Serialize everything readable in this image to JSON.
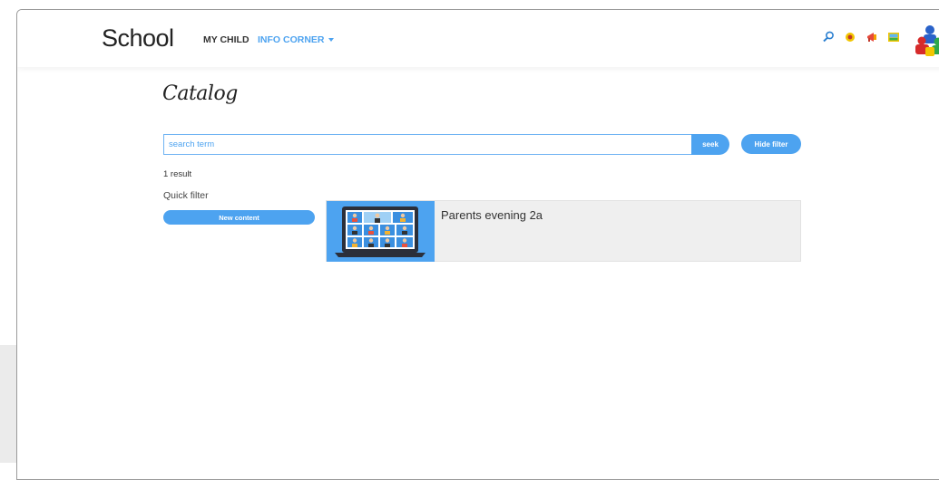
{
  "header": {
    "brand": "School",
    "nav": [
      {
        "label": "MY CHILD"
      },
      {
        "label": "INFO CORNER"
      }
    ],
    "tool_icons": [
      "search-icon",
      "settings-icon",
      "megaphone-icon",
      "pictures-icon"
    ]
  },
  "main": {
    "title": "Catalog",
    "search": {
      "placeholder": "search term",
      "value": "",
      "button": "seek"
    },
    "hide_filter_label": "Hide filter",
    "result_count": "1 result",
    "quick_filter": {
      "label": "Quick filter",
      "button": "New content"
    },
    "results": [
      {
        "title": "Parents evening 2a",
        "thumbnail": "video-conference-icon"
      }
    ]
  },
  "colors": {
    "accent": "#4da3f0",
    "text": "#333333",
    "card_bg": "#efefef"
  }
}
